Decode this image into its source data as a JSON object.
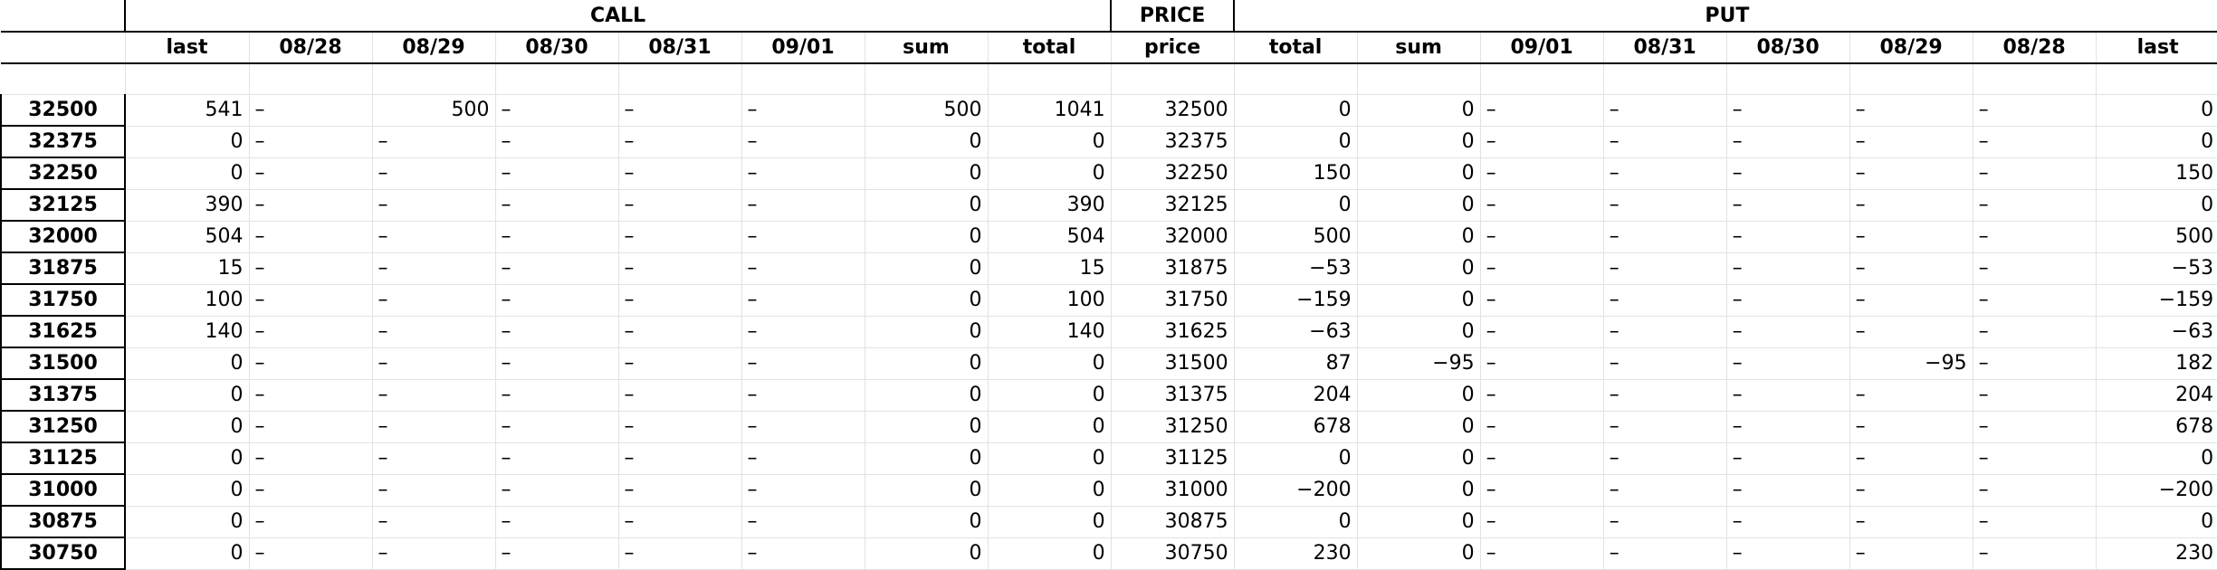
{
  "groups": {
    "call": "CALL",
    "price": "PRICE",
    "put": "PUT"
  },
  "columns": {
    "call": [
      "last",
      "08/28",
      "08/29",
      "08/30",
      "08/31",
      "09/01",
      "sum",
      "total"
    ],
    "price": "price",
    "put": [
      "total",
      "sum",
      "09/01",
      "08/31",
      "08/30",
      "08/29",
      "08/28",
      "last"
    ]
  },
  "rows": [
    {
      "key": "32500",
      "call": [
        "541",
        "–",
        "500",
        "–",
        "–",
        "–",
        "500",
        "1041"
      ],
      "price": "32500",
      "put": [
        "0",
        "0",
        "–",
        "–",
        "–",
        "–",
        "–",
        "0"
      ]
    },
    {
      "key": "32375",
      "call": [
        "0",
        "–",
        "–",
        "–",
        "–",
        "–",
        "0",
        "0"
      ],
      "price": "32375",
      "put": [
        "0",
        "0",
        "–",
        "–",
        "–",
        "–",
        "–",
        "0"
      ]
    },
    {
      "key": "32250",
      "call": [
        "0",
        "–",
        "–",
        "–",
        "–",
        "–",
        "0",
        "0"
      ],
      "price": "32250",
      "put": [
        "150",
        "0",
        "–",
        "–",
        "–",
        "–",
        "–",
        "150"
      ]
    },
    {
      "key": "32125",
      "call": [
        "390",
        "–",
        "–",
        "–",
        "–",
        "–",
        "0",
        "390"
      ],
      "price": "32125",
      "put": [
        "0",
        "0",
        "–",
        "–",
        "–",
        "–",
        "–",
        "0"
      ]
    },
    {
      "key": "32000",
      "call": [
        "504",
        "–",
        "–",
        "–",
        "–",
        "–",
        "0",
        "504"
      ],
      "price": "32000",
      "put": [
        "500",
        "0",
        "–",
        "–",
        "–",
        "–",
        "–",
        "500"
      ]
    },
    {
      "key": "31875",
      "call": [
        "15",
        "–",
        "–",
        "–",
        "–",
        "–",
        "0",
        "15"
      ],
      "price": "31875",
      "put": [
        "−53",
        "0",
        "–",
        "–",
        "–",
        "–",
        "–",
        "−53"
      ]
    },
    {
      "key": "31750",
      "call": [
        "100",
        "–",
        "–",
        "–",
        "–",
        "–",
        "0",
        "100"
      ],
      "price": "31750",
      "put": [
        "−159",
        "0",
        "–",
        "–",
        "–",
        "–",
        "–",
        "−159"
      ]
    },
    {
      "key": "31625",
      "call": [
        "140",
        "–",
        "–",
        "–",
        "–",
        "–",
        "0",
        "140"
      ],
      "price": "31625",
      "put": [
        "−63",
        "0",
        "–",
        "–",
        "–",
        "–",
        "–",
        "−63"
      ]
    },
    {
      "key": "31500",
      "call": [
        "0",
        "–",
        "–",
        "–",
        "–",
        "–",
        "0",
        "0"
      ],
      "price": "31500",
      "put": [
        "87",
        "−95",
        "–",
        "–",
        "–",
        "−95",
        "–",
        "182"
      ]
    },
    {
      "key": "31375",
      "call": [
        "0",
        "–",
        "–",
        "–",
        "–",
        "–",
        "0",
        "0"
      ],
      "price": "31375",
      "put": [
        "204",
        "0",
        "–",
        "–",
        "–",
        "–",
        "–",
        "204"
      ]
    },
    {
      "key": "31250",
      "call": [
        "0",
        "–",
        "–",
        "–",
        "–",
        "–",
        "0",
        "0"
      ],
      "price": "31250",
      "put": [
        "678",
        "0",
        "–",
        "–",
        "–",
        "–",
        "–",
        "678"
      ]
    },
    {
      "key": "31125",
      "call": [
        "0",
        "–",
        "–",
        "–",
        "–",
        "–",
        "0",
        "0"
      ],
      "price": "31125",
      "put": [
        "0",
        "0",
        "–",
        "–",
        "–",
        "–",
        "–",
        "0"
      ]
    },
    {
      "key": "31000",
      "call": [
        "0",
        "–",
        "–",
        "–",
        "–",
        "–",
        "0",
        "0"
      ],
      "price": "31000",
      "put": [
        "−200",
        "0",
        "–",
        "–",
        "–",
        "–",
        "–",
        "−200"
      ]
    },
    {
      "key": "30875",
      "call": [
        "0",
        "–",
        "–",
        "–",
        "–",
        "–",
        "0",
        "0"
      ],
      "price": "30875",
      "put": [
        "0",
        "0",
        "–",
        "–",
        "–",
        "–",
        "–",
        "0"
      ]
    },
    {
      "key": "30750",
      "call": [
        "0",
        "–",
        "–",
        "–",
        "–",
        "–",
        "0",
        "0"
      ],
      "price": "30750",
      "put": [
        "230",
        "0",
        "–",
        "–",
        "–",
        "–",
        "–",
        "230"
      ]
    }
  ]
}
